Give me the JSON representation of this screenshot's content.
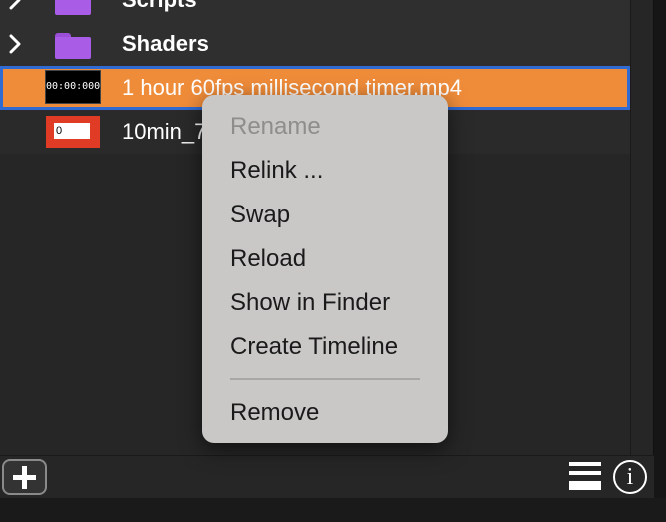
{
  "rows": [
    {
      "label": "Scripts",
      "type": "folder"
    },
    {
      "label": "Shaders",
      "type": "folder"
    },
    {
      "label": "1 hour 60fps millisecond timer.mp4",
      "type": "video",
      "thumbnail_text": "00:00:000",
      "selected": true
    },
    {
      "label": "10min_7",
      "type": "video",
      "thumbnail_text": "0"
    }
  ],
  "context_menu": {
    "items": [
      {
        "label": "Rename",
        "enabled": false
      },
      {
        "label": "Relink ...",
        "enabled": true
      },
      {
        "label": "Swap",
        "enabled": true
      },
      {
        "label": "Reload",
        "enabled": true
      },
      {
        "label": "Show in Finder",
        "enabled": true
      },
      {
        "label": "Create Timeline",
        "enabled": true
      },
      {
        "label": "Remove",
        "enabled": true
      }
    ]
  },
  "toolbar": {
    "add_icon": "plus-icon",
    "list_icon": "list-view-icon",
    "info_label": "i"
  },
  "colors": {
    "selection": "#ef8c3a",
    "selection_border": "#2f6bd3",
    "folder": "#a95de6",
    "menu_background": "#c9c8c7",
    "panel": "#262626"
  }
}
